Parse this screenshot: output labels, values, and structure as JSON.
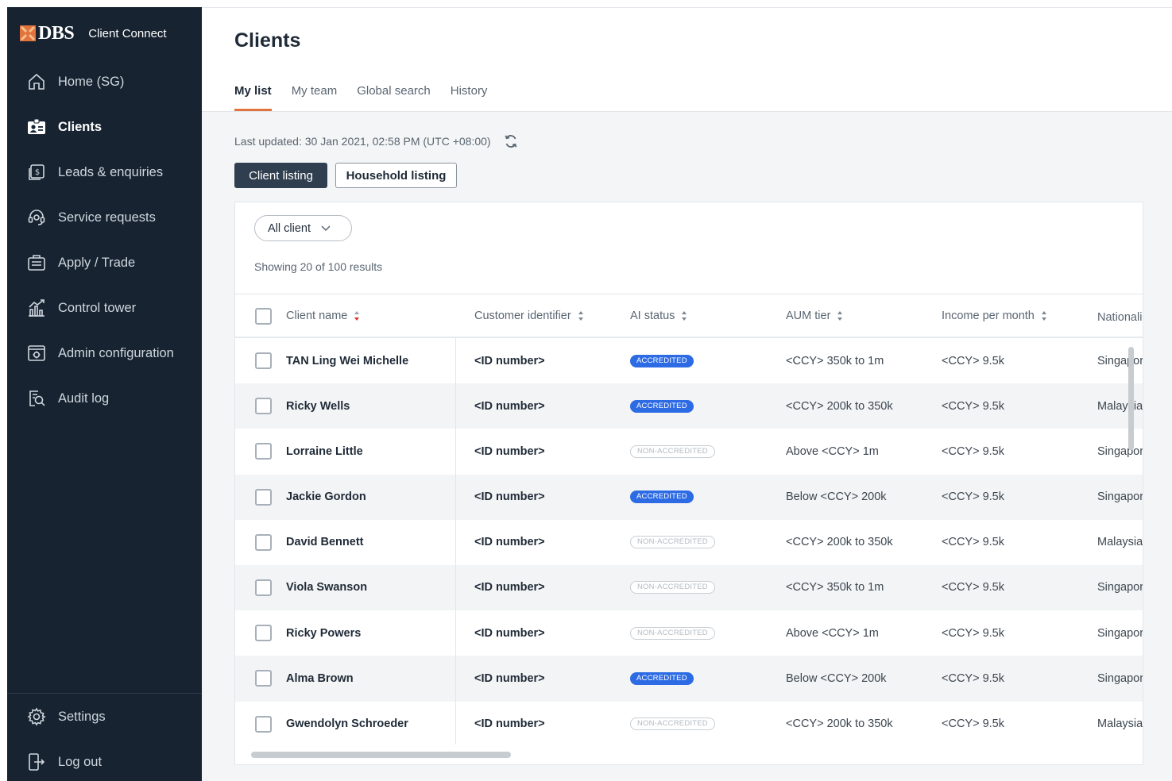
{
  "app": {
    "brand": "DBS",
    "product": "Client Connect"
  },
  "sidebar": {
    "items": [
      {
        "label": "Home (SG)",
        "icon": "home-icon"
      },
      {
        "label": "Clients",
        "icon": "client-card-icon",
        "active": true
      },
      {
        "label": "Leads & enquiries",
        "icon": "leads-icon"
      },
      {
        "label": "Service requests",
        "icon": "headset-icon"
      },
      {
        "label": "Apply / Trade",
        "icon": "briefcase-icon"
      },
      {
        "label": "Control tower",
        "icon": "chart-icon"
      },
      {
        "label": "Admin configuration",
        "icon": "admin-gear-icon"
      },
      {
        "label": "Audit log",
        "icon": "audit-search-icon"
      }
    ],
    "bottom": [
      {
        "label": "Settings",
        "icon": "gear-icon"
      },
      {
        "label": "Log out",
        "icon": "logout-icon"
      }
    ]
  },
  "page": {
    "title": "Clients",
    "tabs": [
      "My list",
      "My team",
      "Global search",
      "History"
    ],
    "active_tab": "My list",
    "last_updated": "Last updated: 30 Jan 2021, 02:58 PM (UTC +08:00)",
    "listing_buttons": {
      "client": "Client listing",
      "household": "Household listing"
    },
    "filter_label": "All client",
    "results_text": "Showing 20 of 100 results"
  },
  "table": {
    "columns": [
      "Client name",
      "Customer identifier",
      "AI status",
      "AUM tier",
      "Income per month",
      "Nationali"
    ],
    "rows": [
      {
        "name": "TAN Ling Wei Michelle",
        "id": "<ID number>",
        "status": "ACCREDITED",
        "aum": "<CCY> 350k to 1m",
        "income": "<CCY> 9.5k",
        "nationality": "Singapor"
      },
      {
        "name": "Ricky Wells",
        "id": "<ID number>",
        "status": "ACCREDITED",
        "aum": "<CCY> 200k to 350k",
        "income": "<CCY> 9.5k",
        "nationality": "Malaysia"
      },
      {
        "name": "Lorraine Little",
        "id": "<ID number>",
        "status": "NON-ACCREDITED",
        "aum": "Above <CCY> 1m",
        "income": "<CCY> 9.5k",
        "nationality": "Singapor"
      },
      {
        "name": "Jackie Gordon",
        "id": "<ID number>",
        "status": "ACCREDITED",
        "aum": "Below <CCY> 200k",
        "income": "<CCY> 9.5k",
        "nationality": "Singapor"
      },
      {
        "name": "David Bennett",
        "id": "<ID number>",
        "status": "NON-ACCREDITED",
        "aum": "<CCY> 200k to 350k",
        "income": "<CCY> 9.5k",
        "nationality": "Malaysia"
      },
      {
        "name": "Viola Swanson",
        "id": "<ID number>",
        "status": "NON-ACCREDITED",
        "aum": "<CCY> 350k to 1m",
        "income": "<CCY> 9.5k",
        "nationality": "Singapor"
      },
      {
        "name": "Ricky Powers",
        "id": "<ID number>",
        "status": "NON-ACCREDITED",
        "aum": "Above <CCY> 1m",
        "income": "<CCY> 9.5k",
        "nationality": "Singapor"
      },
      {
        "name": "Alma Brown",
        "id": "<ID number>",
        "status": "ACCREDITED",
        "aum": "Below <CCY> 200k",
        "income": "<CCY> 9.5k",
        "nationality": "Singapor"
      },
      {
        "name": "Gwendolyn Schroeder",
        "id": "<ID number>",
        "status": "NON-ACCREDITED",
        "aum": "<CCY> 200k to 350k",
        "income": "<CCY> 9.5k",
        "nationality": "Malaysia"
      }
    ]
  },
  "colors": {
    "sidebar_bg": "#172331",
    "accent_orange": "#e2733d",
    "accredited_blue": "#2d6be4",
    "sort_active_red": "#e0312f"
  }
}
